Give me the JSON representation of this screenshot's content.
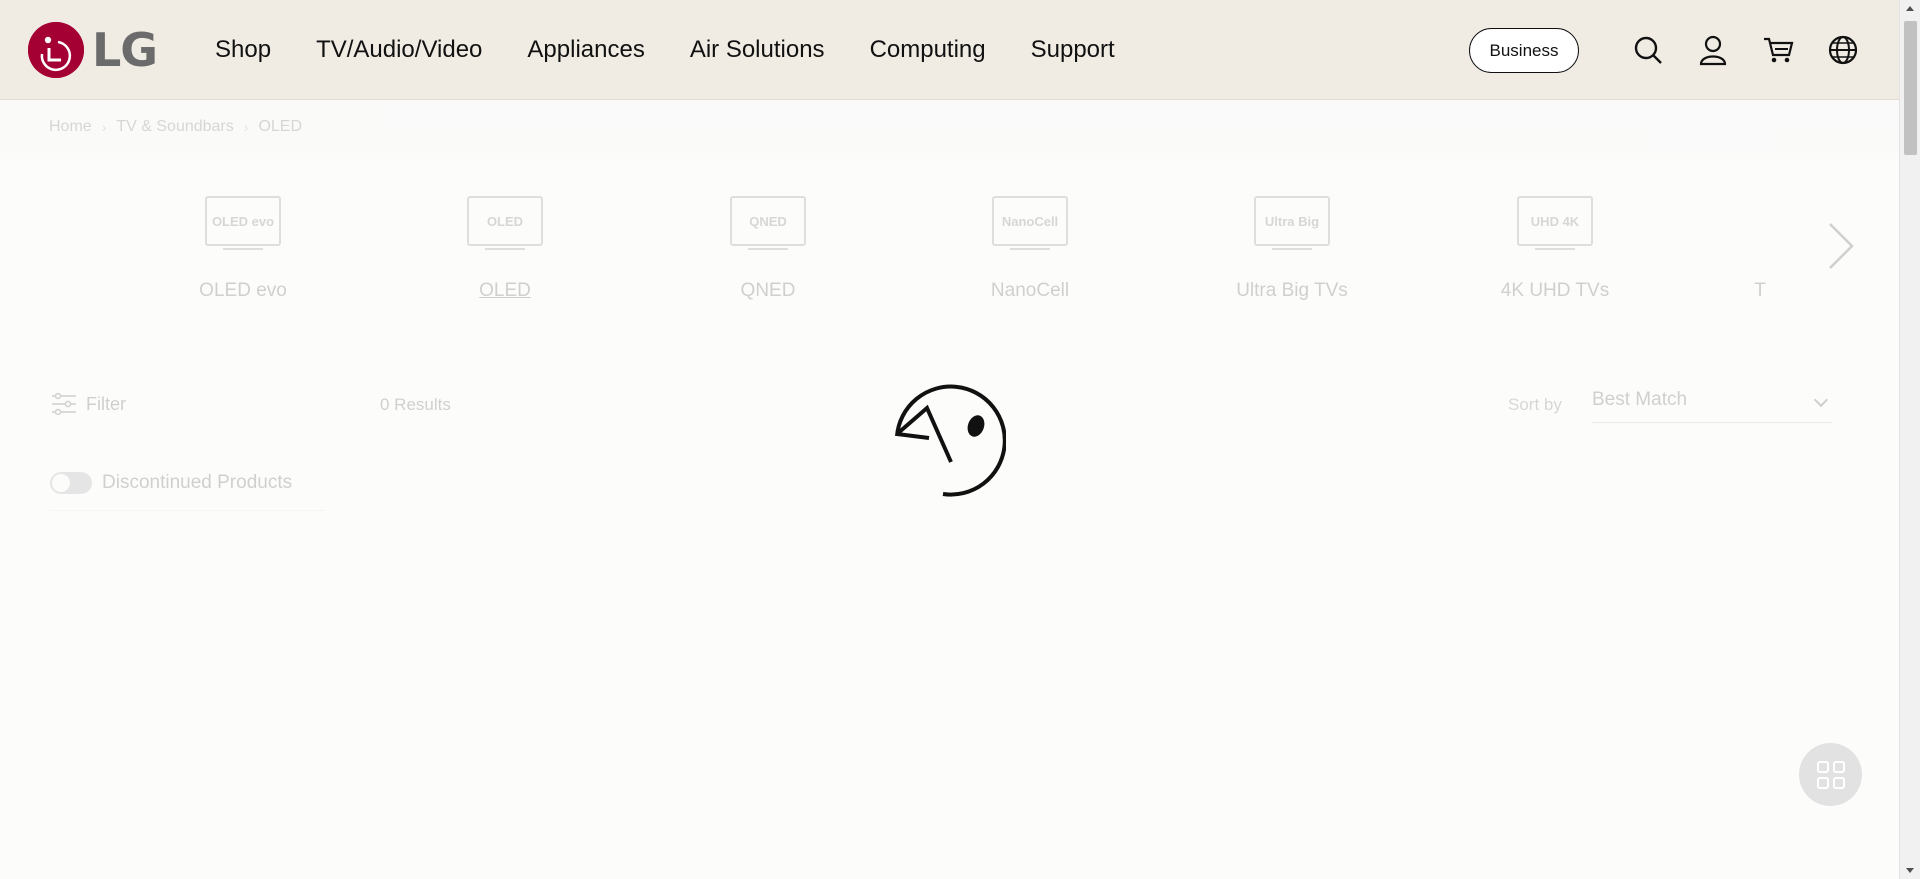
{
  "header": {
    "logo_text": "LG",
    "nav": [
      "Shop",
      "TV/Audio/Video",
      "Appliances",
      "Air Solutions",
      "Computing",
      "Support"
    ],
    "business_label": "Business",
    "icons": [
      "search-icon",
      "account-icon",
      "cart-icon",
      "globe-icon"
    ]
  },
  "breadcrumb": [
    "Home",
    "TV & Soundbars",
    "OLED"
  ],
  "categories": [
    {
      "badge": "OLED evo",
      "label": "OLED evo"
    },
    {
      "badge": "OLED",
      "label": "OLED",
      "active": true
    },
    {
      "badge": "QNED",
      "label": "QNED"
    },
    {
      "badge": "NanoCell",
      "label": "NanoCell"
    },
    {
      "badge": "Ultra Big",
      "label": "Ultra Big TVs"
    },
    {
      "badge": "UHD 4K",
      "label": "4K UHD TVs"
    },
    {
      "badge": "",
      "label": "T"
    }
  ],
  "listing": {
    "filter_label": "Filter",
    "results_text": "0 Results",
    "sort_label": "Sort by",
    "sort_value": "Best Match",
    "discontinued_label": "Discontinued Products"
  },
  "colors": {
    "brand": "#a50034",
    "header_bg": "#f0ece4"
  }
}
